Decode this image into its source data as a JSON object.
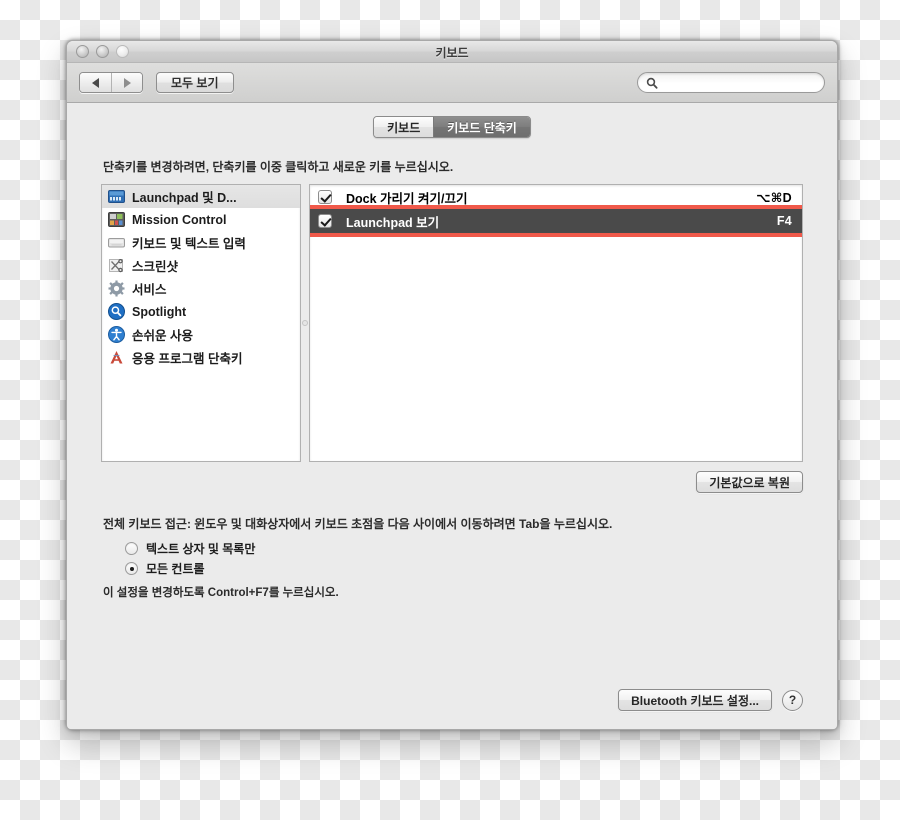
{
  "window": {
    "title": "키보드",
    "traffic_lights": [
      "close-button",
      "minimize-button",
      "zoom-button"
    ]
  },
  "toolbar": {
    "back_icon": "triangle-left-icon",
    "forward_icon": "triangle-right-icon",
    "show_all_label": "모두 보기",
    "search": {
      "icon": "search-icon",
      "value": "",
      "placeholder": ""
    }
  },
  "tabs": [
    {
      "label": "키보드",
      "selected": false
    },
    {
      "label": "키보드 단축키",
      "selected": true
    }
  ],
  "instruction": "단축키를 변경하려면, 단축키를 이중 클릭하고 새로운 키를 누르십시오.",
  "sidebar": {
    "items": [
      {
        "label": "Launchpad 및 D...",
        "icon": "launchpad-dock-icon",
        "selected": true
      },
      {
        "label": "Mission Control",
        "icon": "mission-control-icon",
        "selected": false
      },
      {
        "label": "키보드 및 텍스트 입력",
        "icon": "keyboard-icon",
        "selected": false
      },
      {
        "label": "스크린샷",
        "icon": "screenshot-scissors-icon",
        "selected": false
      },
      {
        "label": "서비스",
        "icon": "gear-icon",
        "selected": false
      },
      {
        "label": "Spotlight",
        "icon": "spotlight-magnifier-icon",
        "selected": false
      },
      {
        "label": "손쉬운 사용",
        "icon": "accessibility-icon",
        "selected": false
      },
      {
        "label": "응용 프로그램 단축키",
        "icon": "app-shortcuts-icon",
        "selected": false
      }
    ]
  },
  "shortcuts": {
    "rows": [
      {
        "checked": true,
        "name": "Dock 가리기 켜기/끄기",
        "key": "⌥⌘D",
        "selected": false,
        "annotated": false
      },
      {
        "checked": true,
        "name": "Launchpad 보기",
        "key": "F4",
        "selected": true,
        "annotated": true
      }
    ]
  },
  "restore_defaults_label": "기본값으로 복원",
  "full_keyboard_access": {
    "title": "전체 키보드 접근: 윈도우 및 대화상자에서 키보드 초점을 다음 사이에서 이동하려면 Tab을 누르십시오.",
    "options": [
      {
        "label": "텍스트 상자 및 목록만",
        "selected": false
      },
      {
        "label": "모든 컨트롤",
        "selected": true
      }
    ],
    "hint": "이 설정을 변경하도록 Control+F7를 누르십시오."
  },
  "footer": {
    "bluetooth_label": "Bluetooth 키보드 설정...",
    "help_label": "?"
  },
  "colors": {
    "annotation_red": "#f0594a",
    "selection_gray": "#4a4a4a",
    "window_bg": "#ebebeb"
  }
}
